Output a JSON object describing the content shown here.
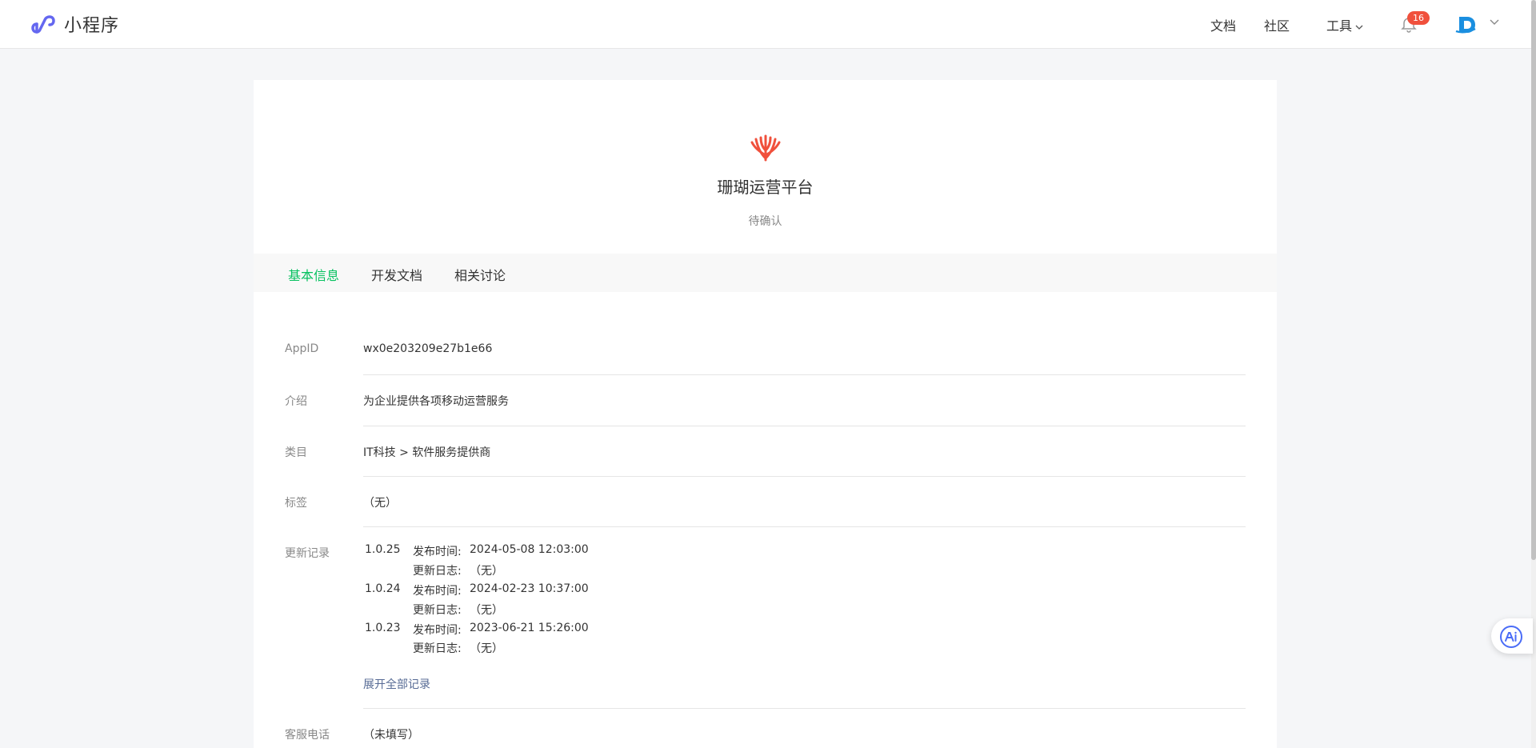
{
  "header": {
    "brand": "小程序",
    "nav": {
      "docs": "文档",
      "community": "社区",
      "tools": "工具"
    },
    "notification_count": "16"
  },
  "app": {
    "name": "珊瑚运营平台",
    "status": "待确认"
  },
  "tabs": [
    "基本信息",
    "开发文档",
    "相关讨论"
  ],
  "info": {
    "appid_label": "AppID",
    "appid_value": "wx0e203209e27b1e66",
    "intro_label": "介绍",
    "intro_value": "为企业提供各项移动运营服务",
    "category_label": "类目",
    "category_value": "IT科技 > 软件服务提供商",
    "tags_label": "标签",
    "tags_value": "（无）",
    "history_label": "更新记录",
    "phone_label": "客服电话",
    "phone_value": "（未填写）"
  },
  "history": [
    {
      "version": "1.0.25",
      "release_label": "发布时间:",
      "release_time": "2024-05-08 12:03:00",
      "log_label": "更新日志:",
      "log_value": "（无）"
    },
    {
      "version": "1.0.24",
      "release_label": "发布时间:",
      "release_time": "2024-02-23 10:37:00",
      "log_label": "更新日志:",
      "log_value": "（无）"
    },
    {
      "version": "1.0.23",
      "release_label": "发布时间:",
      "release_time": "2023-06-21 15:26:00",
      "log_label": "更新日志:",
      "log_value": "（无）"
    }
  ],
  "expand_all": "展开全部记录",
  "colors": {
    "accent": "#07c160",
    "link": "#576b95",
    "badge": "#f0503c",
    "brand_logo": "#6467f0",
    "app_logo": "#f0503c"
  },
  "icons": [
    "miniprogram-logo-icon",
    "chevron-down-icon",
    "bell-icon",
    "avatar",
    "coral-logo-icon",
    "ai-assistant-icon"
  ]
}
